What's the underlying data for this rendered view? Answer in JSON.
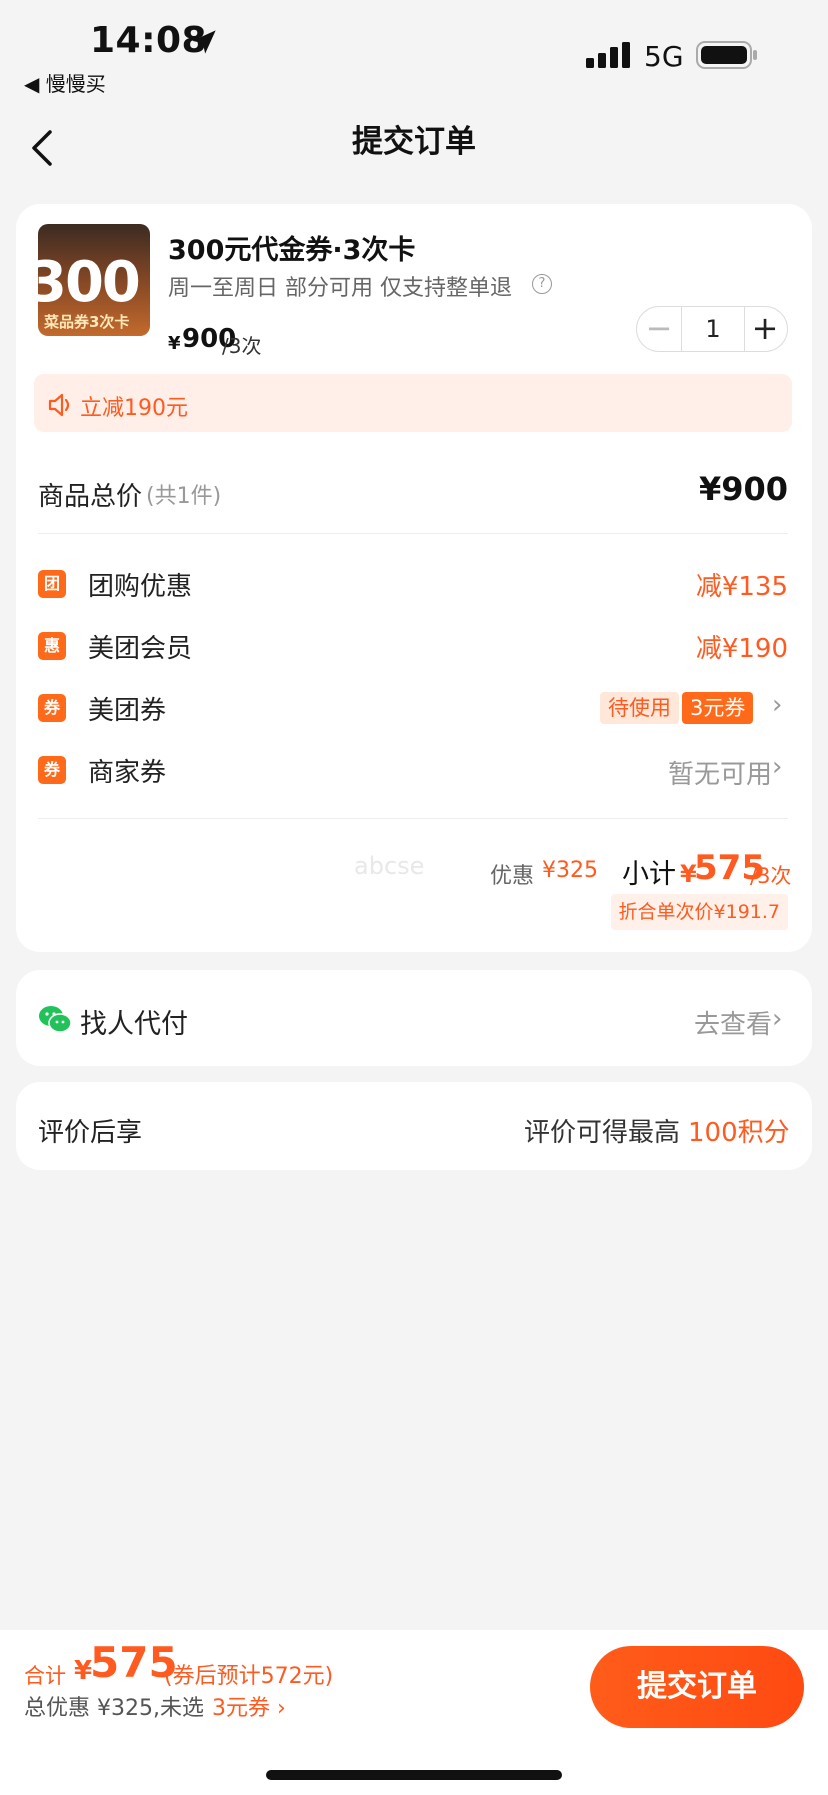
{
  "status_bar": {
    "time": "14:08",
    "back_app": "◀ 慢慢买",
    "network": "5G"
  },
  "nav": {
    "title": "提交订单"
  },
  "product": {
    "thumb_number": "300",
    "thumb_caption": "菜品券3次卡",
    "title": "300元代金券·3次卡",
    "subtitle": "周一至周日 部分可用 仅支持整单退",
    "price_yen": "¥",
    "price": "900",
    "price_unit": "/3次",
    "quantity": "1"
  },
  "discount_banner": "立减190元",
  "total": {
    "label": "商品总价",
    "count": "(共1件)",
    "value": "¥900"
  },
  "discounts": [
    {
      "badge": "团",
      "label": "团购优惠",
      "value": "减¥135"
    },
    {
      "badge": "惠",
      "label": "美团会员",
      "value": "减¥190"
    },
    {
      "badge": "券",
      "label": "美团券",
      "pending": "待使用",
      "tag": "3元券"
    },
    {
      "badge": "券",
      "label": "商家券",
      "value": "暂无可用"
    }
  ],
  "summary": {
    "watermark": "abcse",
    "saving_label": "优惠",
    "saving_value": "¥325",
    "subtotal_label": "小计",
    "subtotal_yen": "¥",
    "subtotal_value": "575",
    "subtotal_unit": "/3次",
    "per_use": "折合单次价¥191.7"
  },
  "pay_for_me": {
    "label": "找人代付",
    "action": "去查看"
  },
  "review": {
    "label": "评价后享",
    "text": "评价可得最高",
    "points": "100积分"
  },
  "bottom": {
    "sum_label": "合计",
    "sum_yen": "¥",
    "sum_value": "575",
    "sum_after": "(券后预计572元)",
    "detail": "总优惠 ¥325,未选",
    "unused": "3元券",
    "submit": "提交订单"
  },
  "colors": {
    "accent": "#ff5a1f",
    "background": "#f4f4f4",
    "card": "#ffffff"
  }
}
